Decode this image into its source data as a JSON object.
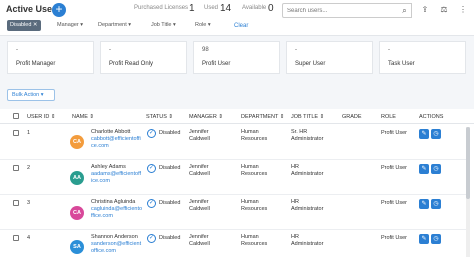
{
  "header": {
    "title": "Active Users",
    "add_label": "+",
    "purchased_label": "Purchased Licenses",
    "purchased_value": "1",
    "used_label": "Used",
    "used_value": "14",
    "available_label": "Available",
    "available_value": "0",
    "search_placeholder": "Search users..."
  },
  "filters": {
    "chip": "Disabled ✕",
    "manager": "Manager ▾",
    "department": "Department ▾",
    "job_title": "Job Title ▾",
    "role": "Role ▾",
    "clear": "Clear"
  },
  "cards": [
    {
      "value": "-",
      "label": "Profit Manager"
    },
    {
      "value": "-",
      "label": "Profit Read Only"
    },
    {
      "value": "98",
      "label": "Profit User"
    },
    {
      "value": "-",
      "label": "Super User"
    },
    {
      "value": "-",
      "label": "Task User"
    }
  ],
  "bulk_action": "Bulk Action ▾",
  "table": {
    "columns": [
      "USER ID ⇕",
      "NAME ⇕",
      "STATUS ⇕",
      "MANAGER ⇕",
      "DEPARTMENT ⇕",
      "JOB TITLE ⇕",
      "GRADE",
      "ROLE",
      "ACTIONS"
    ],
    "rows": [
      {
        "id": "1",
        "initials": "CA",
        "avatar_color": "#f39c3d",
        "name": "Charlotte Abbott",
        "email1": "cabbott@efficientoffi",
        "email2": "ce.com",
        "status": "Disabled",
        "manager1": "Jennifer",
        "manager2": "Caldwell",
        "dept1": "Human",
        "dept2": "Resources",
        "job1": "Sr. HR",
        "job2": "Administrator",
        "role": "Profit User"
      },
      {
        "id": "2",
        "initials": "AA",
        "avatar_color": "#2a9d8f",
        "name": "Ashley Adams",
        "email1": "aadams@efficientoff",
        "email2": "ice.com",
        "status": "Disabled",
        "manager1": "Jennifer",
        "manager2": "Caldwell",
        "dept1": "Human",
        "dept2": "Resources",
        "job1": "HR",
        "job2": "Administrator",
        "role": "Profit User"
      },
      {
        "id": "3",
        "initials": "CA",
        "avatar_color": "#d8489a",
        "name": "Christina Agluinda",
        "email1": "cagluinda@efficiento",
        "email2": "ffice.com",
        "status": "Disabled",
        "manager1": "Jennifer",
        "manager2": "Caldwell",
        "dept1": "Human",
        "dept2": "Resources",
        "job1": "HR",
        "job2": "Administrator",
        "role": "Profit User"
      },
      {
        "id": "4",
        "initials": "SA",
        "avatar_color": "#2b8fd8",
        "name": "Shannon Anderson",
        "email1": "sanderson@efficient",
        "email2": "office.com",
        "status": "Disabled",
        "manager1": "Jennifer",
        "manager2": "Caldwell",
        "dept1": "Human",
        "dept2": "Resources",
        "job1": "HR",
        "job2": "Administrator",
        "role": "Profit User"
      }
    ]
  }
}
